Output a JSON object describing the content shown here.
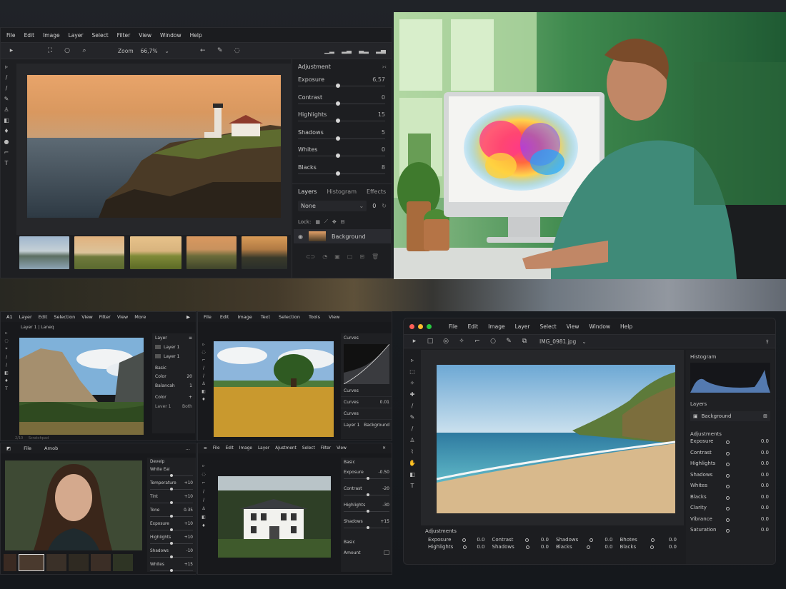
{
  "win1": {
    "menu": [
      "File",
      "Edit",
      "Image",
      "Layer",
      "Select",
      "Filter",
      "View",
      "Window",
      "Help"
    ],
    "zoom_label": "Zoom",
    "zoom_value": "66,7%",
    "adjustment_title": "Adjustment",
    "adjustments": [
      {
        "label": "Exposure",
        "value": "6,57",
        "pos": 0.48
      },
      {
        "label": "Contrast",
        "value": "0",
        "pos": 0.48
      },
      {
        "label": "Highlights",
        "value": "15",
        "pos": 0.48
      },
      {
        "label": "Shadows",
        "value": "5",
        "pos": 0.48
      },
      {
        "label": "Whites",
        "value": "0",
        "pos": 0.48
      },
      {
        "label": "Blacks",
        "value": "8",
        "pos": 0.48
      }
    ],
    "layer_tabs": [
      "Layers",
      "Histogram",
      "Effects"
    ],
    "blend_mode": "None",
    "opacity": "0",
    "lock_label": "Lock:",
    "layer_name": "Background"
  },
  "win2": {
    "title": "A1",
    "menu": [
      "Layer",
      "Edit",
      "Selection",
      "View",
      "Filter",
      "View",
      "More"
    ],
    "doc_tab": "Layer 1 | Laneq",
    "layer_panel_title": "Layer",
    "layers": [
      "Layer 1",
      "Layer 1"
    ],
    "basic_title": "Basic",
    "basic_rows": [
      {
        "label": "Color",
        "value": "20"
      },
      {
        "label": "Balancah",
        "value": "1"
      }
    ],
    "color_label": "Color",
    "footer_left": "Laver 1",
    "footer_right": "Both",
    "bottom_left": "2/10",
    "bottom_right": "Scratchpad"
  },
  "win3": {
    "menu": [
      "File",
      "Edit",
      "Image",
      "Text",
      "Selection",
      "Tools",
      "View"
    ],
    "curves_title": "Curves",
    "curves_rows": [
      {
        "label": "Curves",
        "value": ""
      },
      {
        "label": "Curves",
        "value": "0.01"
      },
      {
        "label": "Curves",
        "value": ""
      }
    ],
    "layer_label": "Layer 1",
    "layer_value": "Background"
  },
  "win4": {
    "menu": [
      "File",
      "Arnob"
    ],
    "panel_title": "Develp",
    "rows": [
      {
        "label": "White Eal",
        "value": ""
      },
      {
        "label": "Temperature",
        "value": "+10"
      },
      {
        "label": "Tint",
        "value": "+10"
      },
      {
        "label": "Tone",
        "value": "0.35"
      },
      {
        "label": "Exposure",
        "value": "+10"
      },
      {
        "label": "Highlights",
        "value": "+10"
      },
      {
        "label": "Shadows",
        "value": "-10"
      },
      {
        "label": "Whites",
        "value": "+15"
      }
    ]
  },
  "win5": {
    "menu": [
      "File",
      "Edit",
      "Image",
      "Layer",
      "Ajustment",
      "Select",
      "Filter",
      "View"
    ],
    "basic_title": "Basic",
    "rows": [
      {
        "label": "Exposure",
        "value": "-0.50"
      },
      {
        "label": "Contrast",
        "value": "-20"
      },
      {
        "label": "Highlights",
        "value": "-30"
      },
      {
        "label": "Shadows",
        "value": "+15"
      }
    ],
    "basic2_title": "Basic",
    "amount_label": "Amount"
  },
  "win6": {
    "menu": [
      "File",
      "Edit",
      "Image",
      "Layer",
      "Select",
      "View",
      "Window",
      "Help"
    ],
    "file_name": "IMG_0981.jpg",
    "histogram_title": "Histogram",
    "layers_title": "Layers",
    "layer_name": "Background",
    "adjustments_title": "Adjustments",
    "adjustments": [
      {
        "label": "Exposure",
        "value": "0.0"
      },
      {
        "label": "Contrast",
        "value": "0.0"
      },
      {
        "label": "Highlights",
        "value": "0.0"
      },
      {
        "label": "Shadows",
        "value": "0.0"
      },
      {
        "label": "Whites",
        "value": "0.0"
      },
      {
        "label": "Blacks",
        "value": "0.0"
      },
      {
        "label": "Clarity",
        "value": "0.0"
      },
      {
        "label": "Vibrance",
        "value": "0.0"
      },
      {
        "label": "Saturation",
        "value": "0.0"
      }
    ],
    "bottom_title": "Adjustments",
    "bottom_rows": [
      [
        {
          "label": "Exposure",
          "value": "0.0"
        },
        {
          "label": "Contrast",
          "value": "0.0"
        },
        {
          "label": "Shadows",
          "value": "0.0"
        },
        {
          "label": "Bhotes",
          "value": "0.0"
        }
      ],
      [
        {
          "label": "Highlights",
          "value": "0.0"
        },
        {
          "label": "Shadows",
          "value": "0.0"
        },
        {
          "label": "Blacks",
          "value": "0.0"
        },
        {
          "label": "Blacks",
          "value": "0.0"
        }
      ]
    ]
  },
  "colors": {
    "window_bg": "#1e1f22",
    "panel_bg": "#1d1e21",
    "accent_mac_red": "#ff5f57",
    "accent_mac_yellow": "#febc2e",
    "accent_mac_green": "#28c840"
  }
}
